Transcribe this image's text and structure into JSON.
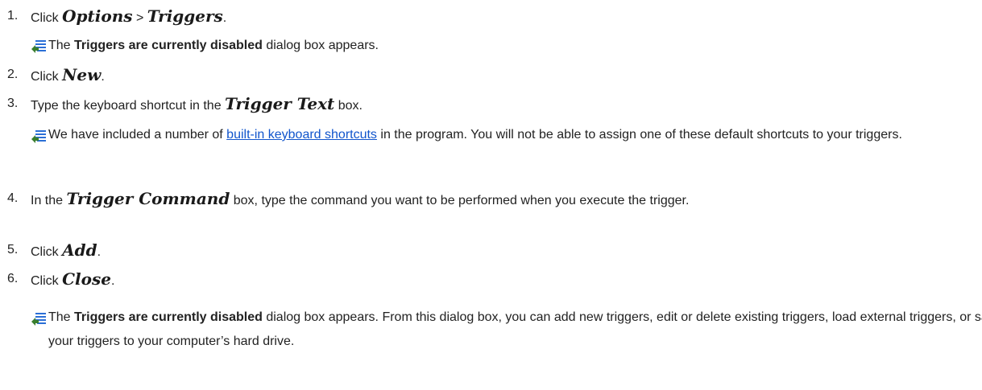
{
  "steps": [
    {
      "num": "1.",
      "pre": "Click ",
      "term1": "Options",
      "sep": " > ",
      "term2": "Triggers",
      "post": "."
    },
    {
      "num": "2.",
      "pre": "Click ",
      "term": "New",
      "post": "."
    },
    {
      "num": "3.",
      "pre": "Type the keyboard shortcut in the ",
      "term": "Trigger Text",
      "post": " box."
    },
    {
      "num": "4.",
      "pre": "In the ",
      "term": "Trigger Command",
      "post": " box, type the command you want to be performed when you execute the trigger."
    },
    {
      "num": "5.",
      "pre": "Click ",
      "term": "Add",
      "post": "."
    },
    {
      "num": "6.",
      "pre": "Click ",
      "term": "Close",
      "post": "."
    }
  ],
  "notes": {
    "after_step1": {
      "pre": "The ",
      "bold": "Triggers are currently disabled",
      "post": " dialog box appears."
    },
    "after_step3": {
      "pre": "We have included a number of ",
      "link": "built-in keyboard shortcuts",
      "post": " in the program. You will not be able to assign one of these default shortcuts to your triggers."
    },
    "after_step6": {
      "pre": "The ",
      "bold": "Triggers are currently disabled",
      "post": " dialog box appears. From this dialog box, you can add new triggers, edit or delete existing triggers, load external triggers, or save your triggers to your computer’s hard drive."
    }
  },
  "icons": {
    "note_icon": "note-icon",
    "accent": "#2b6fd6"
  }
}
